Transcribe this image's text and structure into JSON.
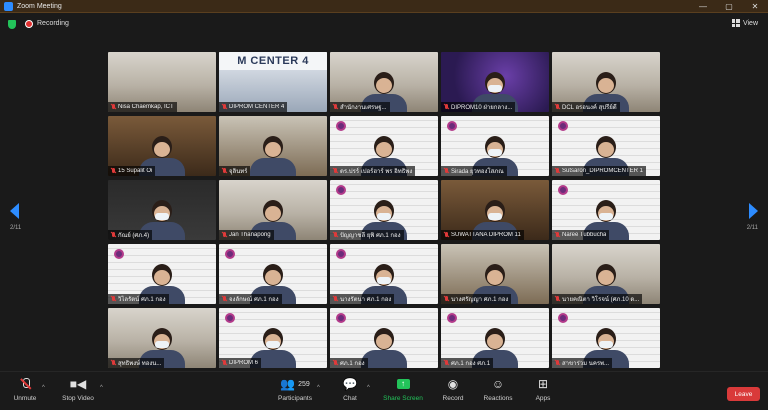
{
  "window": {
    "title": "Zoom Meeting",
    "controls": [
      "—",
      "▢",
      "✕"
    ]
  },
  "topbar": {
    "recording_label": "Recording",
    "view_label": "View"
  },
  "navigation": {
    "page_left": "2/11",
    "page_right": "2/11"
  },
  "tiles": [
    {
      "name": "Nisa Chaemkap, ICT",
      "style": "office",
      "person": false
    },
    {
      "name": "DIPROM CENTER 4",
      "style": "blue",
      "person": false,
      "banner": "M CENTER 4"
    },
    {
      "name": "สำนักงานเศรษฐ...",
      "style": "office",
      "person": true,
      "mask": false
    },
    {
      "name": "DIPROM10 ฝ่ายกลาง...",
      "style": "purple",
      "person": true,
      "mask": true
    },
    {
      "name": "DCL อรอนงค์ สุปรีย์ดี",
      "style": "office",
      "person": true,
      "mask": false
    },
    {
      "name": "15 Supalit Oi",
      "style": "warm",
      "person": true,
      "mask": false
    },
    {
      "name": "จุลินทร์",
      "style": "wood",
      "person": true,
      "mask": false
    },
    {
      "name": "ดร.ปรร์ เปอร์ฮาร์ พร อิทธิพง",
      "style": "slide",
      "person": true,
      "mask": false,
      "logo": true
    },
    {
      "name": "Sirada ยุวทองโสภณ",
      "style": "slide",
      "person": true,
      "mask": true,
      "logo": true
    },
    {
      "name": "Sutsaron_DIPROMCENTER 1",
      "style": "slide",
      "person": true,
      "mask": false,
      "logo": true
    },
    {
      "name": "กัณย์ (ศภ.4)",
      "style": "dark",
      "person": true,
      "mask": true
    },
    {
      "name": "Jan Thanapong",
      "style": "office",
      "person": true,
      "mask": false
    },
    {
      "name": "ปัญญาชลี ยุพิ ศภ.1 กอง",
      "style": "slide",
      "person": true,
      "mask": true,
      "logo": true
    },
    {
      "name": "SUWATTANA DIPROM 11",
      "style": "warm",
      "person": true,
      "mask": true
    },
    {
      "name": "Naree Tubbucha",
      "style": "slide",
      "person": true,
      "mask": true,
      "logo": true
    },
    {
      "name": "วิไลรัตน์ ศภ.1 กอง",
      "style": "slide",
      "person": true,
      "mask": false,
      "logo": true
    },
    {
      "name": "จงลักษณ์ ศภ.1 กอง",
      "style": "slide",
      "person": true,
      "mask": false,
      "logo": true
    },
    {
      "name": "นางรัตนา ศภ.1 กอง",
      "style": "slide",
      "person": true,
      "mask": true,
      "logo": true
    },
    {
      "name": "นางศรัญญา ศภ.1 กอง",
      "style": "wood",
      "person": true,
      "mask": false
    },
    {
      "name": "นายคณิตา วิโรจน์ (ศภ.10 ด...",
      "style": "office",
      "person": true,
      "mask": false
    },
    {
      "name": "สุทธิพงษ์ ทองน...",
      "style": "office",
      "person": true,
      "mask": true
    },
    {
      "name": "DIPROM 6",
      "style": "slide",
      "person": true,
      "mask": true,
      "logo": true
    },
    {
      "name": "ศภ.1 กอง",
      "style": "slide",
      "person": true,
      "mask": false,
      "logo": true
    },
    {
      "name": "ศภ.1 กอง ศภ.1",
      "style": "slide",
      "person": true,
      "mask": false,
      "logo": true
    },
    {
      "name": "สาขาร่วม นครพ...",
      "style": "slide",
      "person": true,
      "mask": true,
      "logo": true
    }
  ],
  "toolbar": {
    "unmute": "Unmute",
    "stop_video": "Stop Video",
    "participants": "Participants",
    "participant_count": "259",
    "chat": "Chat",
    "share_screen": "Share Screen",
    "record": "Record",
    "reactions": "Reactions",
    "apps": "Apps",
    "leave": "Leave"
  }
}
